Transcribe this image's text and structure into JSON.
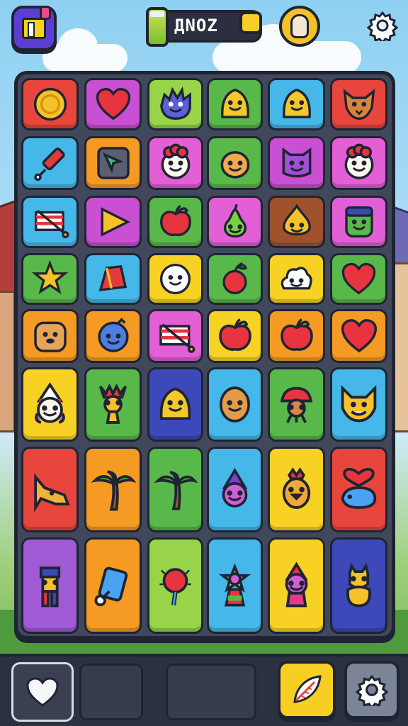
{
  "header": {
    "score": "ДNOZ",
    "icons": {
      "menu": "menu-card-icon",
      "can": "energy-can-icon",
      "coin": "coin-icon",
      "avatar": "llama-avatar-icon",
      "settings": "gear-icon"
    }
  },
  "board": {
    "columns": 6,
    "rows": 8,
    "tiles": [
      {
        "icon": "coin",
        "color": "#e8453c"
      },
      {
        "icon": "heart",
        "color": "#c94fd3"
      },
      {
        "icon": "spiky-creature",
        "color": "#97d44a"
      },
      {
        "icon": "blob-creature",
        "color": "#58b84a"
      },
      {
        "icon": "blob-creature",
        "color": "#45b7e8"
      },
      {
        "icon": "wolf-face",
        "color": "#e8453c"
      },
      {
        "icon": "paintbrush",
        "color": "#45b7e8"
      },
      {
        "icon": "arrow-cursor",
        "color": "#f59b24"
      },
      {
        "icon": "clown-face",
        "color": "#e25fd6"
      },
      {
        "icon": "blob-face",
        "color": "#58b84a"
      },
      {
        "icon": "cat-face",
        "color": "#c94fd3"
      },
      {
        "icon": "clown-face",
        "color": "#e25fd6"
      },
      {
        "icon": "flag",
        "color": "#45b7e8"
      },
      {
        "icon": "play-triangle",
        "color": "#c94fd3"
      },
      {
        "icon": "apple",
        "color": "#58b84a"
      },
      {
        "icon": "pear",
        "color": "#e25fd6"
      },
      {
        "icon": "drop-creature",
        "color": "#a0522d"
      },
      {
        "icon": "square-monster",
        "color": "#e25fd6"
      },
      {
        "icon": "star",
        "color": "#58b84a"
      },
      {
        "icon": "block",
        "color": "#45b7e8"
      },
      {
        "icon": "smiley-face",
        "color": "#f7d225"
      },
      {
        "icon": "cherry",
        "color": "#58b84a"
      },
      {
        "icon": "cloud-face",
        "color": "#f7d225"
      },
      {
        "icon": "heart",
        "color": "#58b84a"
      },
      {
        "icon": "dog-face",
        "color": "#f59b24"
      },
      {
        "icon": "blueberry-face",
        "color": "#f59b24"
      },
      {
        "icon": "flag",
        "color": "#e25fd6"
      },
      {
        "icon": "apple",
        "color": "#f7d225"
      },
      {
        "icon": "apple",
        "color": "#f59b24"
      },
      {
        "icon": "heart",
        "color": "#f59b24"
      },
      {
        "icon": "wizard-face",
        "color": "#f7d225"
      },
      {
        "icon": "tiki-creature",
        "color": "#58b84a"
      },
      {
        "icon": "blob-creature",
        "color": "#3d49b8"
      },
      {
        "icon": "potato-face",
        "color": "#45b7e8"
      },
      {
        "icon": "mushroom-man",
        "color": "#58b84a"
      },
      {
        "icon": "fox-face",
        "color": "#45b7e8"
      },
      {
        "icon": "horse-head",
        "color": "#e8453c"
      },
      {
        "icon": "palm-tree",
        "color": "#f59b24"
      },
      {
        "icon": "palm-tree",
        "color": "#58b84a"
      },
      {
        "icon": "gnome-face",
        "color": "#45b7e8"
      },
      {
        "icon": "rooster",
        "color": "#f7d225"
      },
      {
        "icon": "heart-whale",
        "color": "#e8453c"
      },
      {
        "icon": "totem",
        "color": "#a05ad6"
      },
      {
        "icon": "paint-can",
        "color": "#f59b24"
      },
      {
        "icon": "lollipop",
        "color": "#97d44a"
      },
      {
        "icon": "star-trophy",
        "color": "#45b7e8"
      },
      {
        "icon": "wizard-creature",
        "color": "#f7d225"
      },
      {
        "icon": "dog-sitting",
        "color": "#3d49b8"
      }
    ]
  },
  "footer": {
    "heart_button_icon": "heart-icon",
    "leaf_button_icon": "leaf-icon",
    "gear_button_icon": "gear-icon"
  }
}
